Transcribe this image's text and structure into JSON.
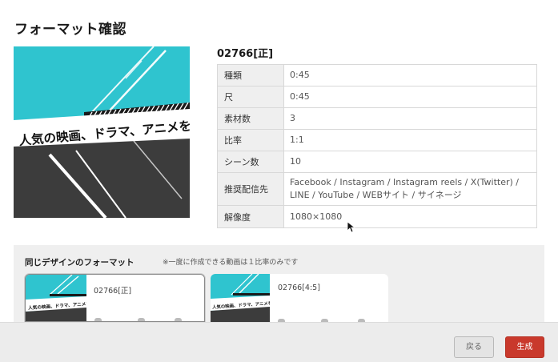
{
  "page": {
    "title": "フォーマット確認"
  },
  "preview": {
    "caption": "人気の映画、ドラマ、アニメを",
    "colors": {
      "accent": "#2fc4cf",
      "dark": "#3c3c3c"
    }
  },
  "format": {
    "id": "02766[正]",
    "specs": [
      {
        "label": "種類",
        "value": "0:45"
      },
      {
        "label": "尺",
        "value": "0:45"
      },
      {
        "label": "素材数",
        "value": "3"
      },
      {
        "label": "比率",
        "value": "1:1"
      },
      {
        "label": "シーン数",
        "value": "10"
      },
      {
        "label": "推奨配信先",
        "value": "Facebook / Instagram / Instagram reels / X(Twitter) / LINE / YouTube / WEBサイト / サイネージ"
      },
      {
        "label": "解像度",
        "value": "1080×1080"
      }
    ]
  },
  "same_design": {
    "title": "同じデザインのフォーマット",
    "note": "※一度に作成できる動画は１比率のみです",
    "cards": [
      {
        "id": "02766[正]",
        "thumb_caption": "人気の映画、ドラマ、アニメを",
        "selected": true
      },
      {
        "id": "02766[4:5]",
        "thumb_caption": "人気の映画、ドラマ、アニメを",
        "selected": false
      }
    ]
  },
  "footer": {
    "back_label": "戻る",
    "create_label": "生成"
  }
}
